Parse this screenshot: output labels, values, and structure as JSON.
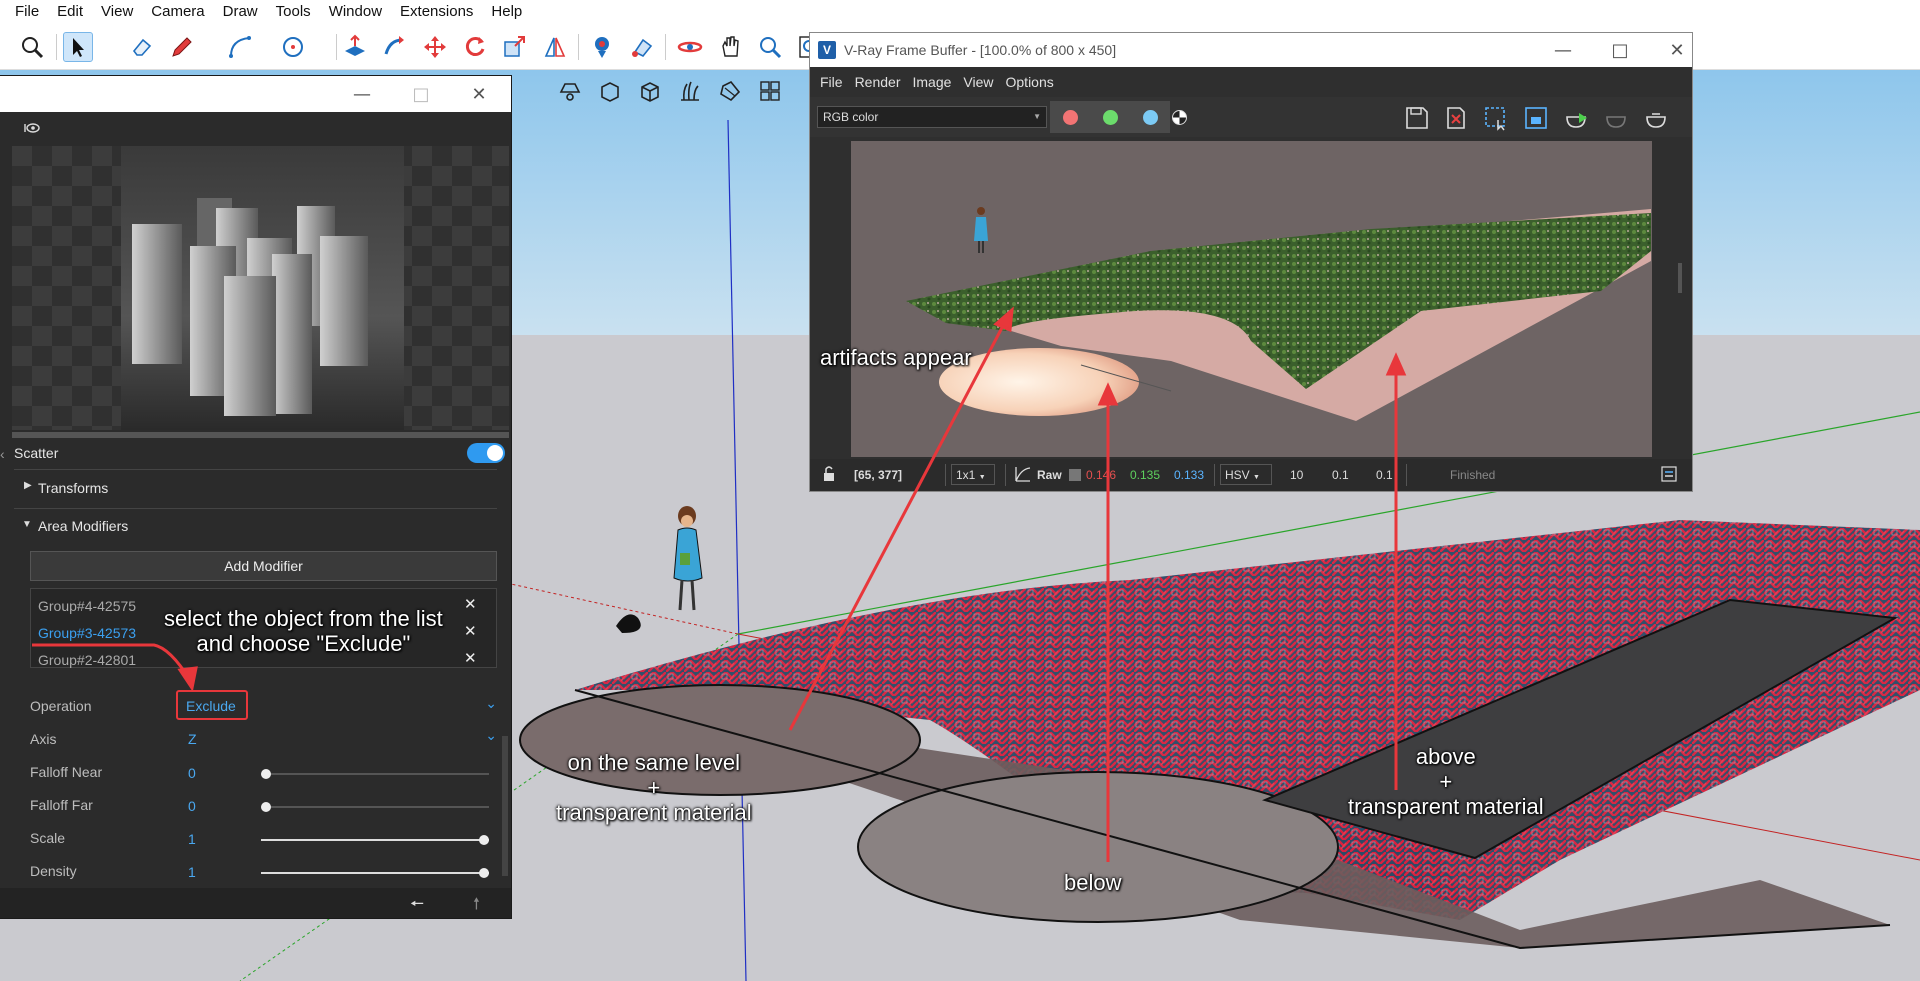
{
  "menubar": {
    "items": [
      "File",
      "Edit",
      "View",
      "Camera",
      "Draw",
      "Tools",
      "Window",
      "Extensions",
      "Help"
    ]
  },
  "toolbar": {
    "icons": [
      "search-icon",
      "select-arrow-icon",
      "eraser-icon",
      "pencil-icon",
      "arc-icon",
      "circle-icon",
      "push-pull-icon",
      "follow-me-icon",
      "move-icon",
      "rotate-icon",
      "scale-icon",
      "flip-icon",
      "position-camera-icon",
      "paint-icon",
      "orbit-icon",
      "pan-icon",
      "zoom-icon",
      "zoom-extents-icon"
    ],
    "second_row_icons": [
      "vray-light-icon",
      "vray-proxy-icon",
      "vray-box-icon",
      "vray-fur-icon",
      "vray-decal-icon",
      "vray-scatter-icon",
      "vray-grid-icon"
    ]
  },
  "scatter_panel": {
    "rows": {
      "scatter": "Scatter",
      "transforms": "Transforms",
      "area_modifiers": "Area Modifiers"
    },
    "add_modifier_label": "Add Modifier",
    "modifiers": [
      {
        "name": "Group#4-42575",
        "selected": false
      },
      {
        "name": "Group#3-42573",
        "selected": true
      },
      {
        "name": "Group#2-42801",
        "selected": false
      }
    ],
    "params": {
      "operation": {
        "label": "Operation",
        "value": "Exclude"
      },
      "axis": {
        "label": "Axis",
        "value": "Z"
      },
      "falloff_near": {
        "label": "Falloff Near",
        "value": "0",
        "level": 0
      },
      "falloff_far": {
        "label": "Falloff Far",
        "value": "0",
        "level": 0
      },
      "scale": {
        "label": "Scale",
        "value": "1",
        "level": 1
      },
      "density": {
        "label": "Density",
        "value": "1",
        "level": 1
      }
    },
    "scatter_enabled": true,
    "accent_color": "#3ba0f0"
  },
  "vfb": {
    "title": "V-Ray Frame Buffer - [100.0% of 800 x 450]",
    "menu": [
      "File",
      "Render",
      "Image",
      "View",
      "Options"
    ],
    "channel": "RGB color",
    "status": {
      "coords": "[65, 377]",
      "zoom": "1x1",
      "raw_label": "Raw",
      "r": "0.146",
      "g": "0.135",
      "b": "0.133",
      "mode": "HSV",
      "h": "10",
      "s": "0.1",
      "v": "0.1",
      "state": "Finished"
    }
  },
  "annotations": {
    "select_object": "select the object from the list\nand choose \"Exclude\"",
    "artifacts": "artifacts appear",
    "same_level": "on the same level\n+\ntransparent material",
    "below": "below",
    "above": "above\n+\ntransparent material"
  },
  "colors": {
    "annotation_arrow": "#e8373b",
    "scatter_red": "#d9213e",
    "scatter_blue": "#2d4a66"
  }
}
